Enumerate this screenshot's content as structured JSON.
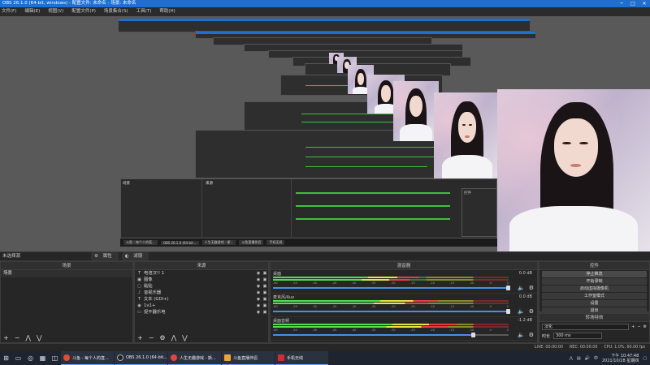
{
  "window": {
    "title": "OBS 26.1.0 (64-bit, windows) - 配置文件: 未命名 - 场景: 未命名"
  },
  "menu": [
    "文件(F)",
    "编辑(E)",
    "视图(V)",
    "配置文件(P)",
    "场景集合(S)",
    "工具(T)",
    "帮助(H)"
  ],
  "scene_bar": {
    "label": "未选择源",
    "properties": "属性",
    "filters": "滤镜"
  },
  "scenes": {
    "header": "场景",
    "items": [
      "场景"
    ]
  },
  "sources": {
    "header": "来源",
    "items": [
      {
        "icon": "text-icon",
        "glyph": "T",
        "label": "电渲汉!! 1"
      },
      {
        "icon": "image-icon",
        "glyph": "▣",
        "label": "图像"
      },
      {
        "icon": "paste-icon",
        "glyph": "▢",
        "label": "黏贴"
      },
      {
        "icon": "speaker-icon",
        "glyph": "♪",
        "label": "音视乐器"
      },
      {
        "icon": "text-icon",
        "glyph": "T",
        "label": "文本 (GDI+)"
      },
      {
        "icon": "browser-icon",
        "glyph": "◉",
        "label": "1v1+"
      },
      {
        "icon": "camera-icon",
        "glyph": "▭",
        "label": "捉不器乐电"
      }
    ]
  },
  "mixer": {
    "header": "混音器",
    "channels": [
      {
        "name": "桌面",
        "db": "0.0 dB",
        "level": 0.62,
        "volume": 1.0
      },
      {
        "name": "麦克风/Aux",
        "db": "0.0 dB",
        "level": 0.7,
        "volume": 1.0
      },
      {
        "name": "桌面音频",
        "db": "-1.2 dB",
        "level": 0.78,
        "volume": 0.85
      }
    ],
    "ticks": [
      "-60",
      "-55",
      "-50",
      "-45",
      "-40",
      "-35",
      "-30",
      "-25",
      "-20",
      "-15",
      "-10",
      "-5",
      "0"
    ]
  },
  "controls": {
    "header": "控件",
    "buttons": [
      "停止推流",
      "开始录制",
      "启动虚拟摄像机",
      "工作室模式",
      "设置",
      "退出"
    ]
  },
  "transitions": {
    "header": "转场特效",
    "select": "淡化",
    "duration_label": "时长",
    "duration": "300 ms"
  },
  "status": {
    "live": "LIVE: 00:00:00",
    "rec": "REC: 00:00:00",
    "cpu": "CPU: 1.0%, 60.00 fps"
  },
  "taskbar": {
    "apps": [
      {
        "label": "斗鱼 - 每个人的直...",
        "color": "#e94a2c"
      },
      {
        "label": "OBS 26.1.0 (64-bit...",
        "color": "#2a2a2a"
      },
      {
        "label": "人生无趣游戏 - 斯...",
        "color": "#e8433a"
      },
      {
        "label": "斗鱼直播伴侣",
        "color": "#f2a22e"
      },
      {
        "label": "手机无线",
        "color": "#d12d2d"
      }
    ],
    "time": "下午 10:47:48",
    "date": "2021/10/28 星期四",
    "ime": "中"
  },
  "nested_dock": {
    "scenes": "场景",
    "sources": "来源",
    "mixer": "混音器",
    "controls": "控件"
  },
  "colors": {
    "accent": "#1f6fd0",
    "meter_green": "#4fdf4f",
    "meter_yellow": "#e6e640",
    "meter_red": "#e64040",
    "fader": "#4a8ee8"
  }
}
